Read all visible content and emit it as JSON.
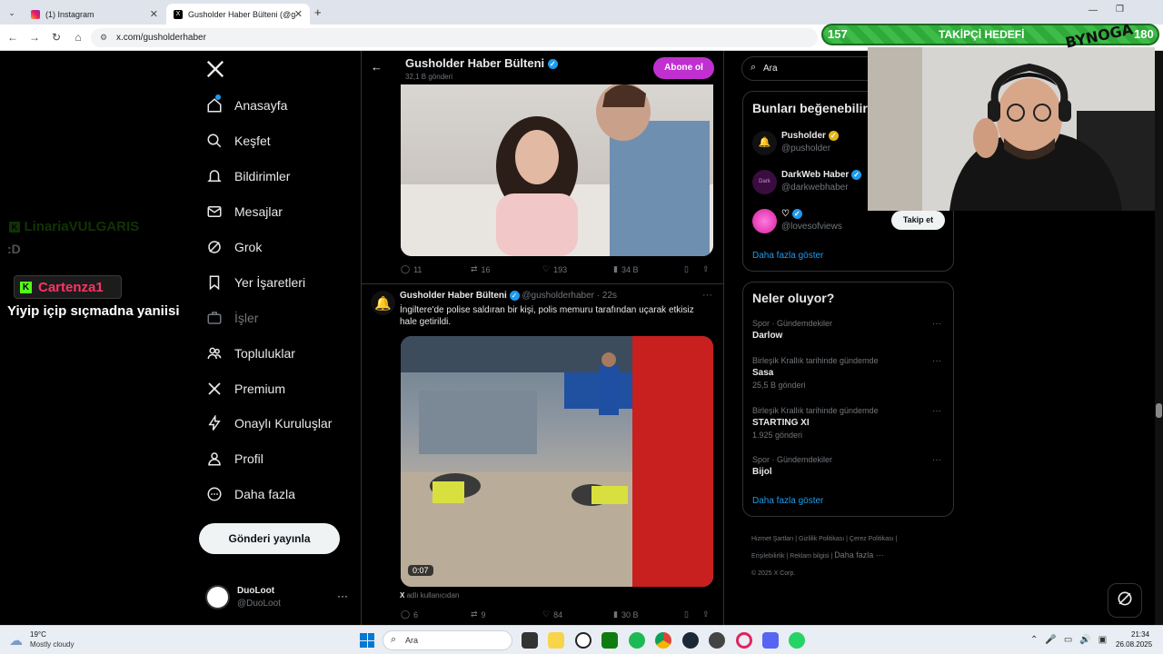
{
  "browser": {
    "tabs": [
      {
        "title": "(1) Instagram",
        "active": false
      },
      {
        "title": "Gusholder Haber Bülteni (@gus",
        "active": true
      }
    ],
    "url": "x.com/gusholderhaber"
  },
  "nav": {
    "items": [
      {
        "label": "Anasayfa",
        "icon": "home-icon"
      },
      {
        "label": "Keşfet",
        "icon": "search-icon"
      },
      {
        "label": "Bildirimler",
        "icon": "bell-icon"
      },
      {
        "label": "Mesajlar",
        "icon": "mail-icon"
      },
      {
        "label": "Grok",
        "icon": "grok-icon"
      },
      {
        "label": "Yer İşaretleri",
        "icon": "bookmark-icon"
      },
      {
        "label": "İşler",
        "icon": "briefcase-icon"
      },
      {
        "label": "Topluluklar",
        "icon": "people-icon"
      },
      {
        "label": "Premium",
        "icon": "x-logo-icon"
      },
      {
        "label": "Onaylı Kuruluşlar",
        "icon": "lightning-icon"
      },
      {
        "label": "Profil",
        "icon": "person-icon"
      },
      {
        "label": "Daha fazla",
        "icon": "more-circle-icon"
      }
    ],
    "post_button": "Gönderi yayınla",
    "account": {
      "name": "DuoLoot",
      "handle": "@DuoLoot"
    }
  },
  "profile_header": {
    "name": "Gusholder Haber Bülteni",
    "posts": "32,1 B gönderi",
    "subscribe": "Abone ol"
  },
  "tweet1": {
    "replies": "11",
    "retweets": "16",
    "likes": "193",
    "views": "34 B"
  },
  "tweet2": {
    "name": "Gusholder Haber Bülteni",
    "handle": "@gusholderhaber",
    "time": "· 22s",
    "text": "İngiltere'de polise saldıran bir kişi, polis memuru tarafından uçarak etkisiz hale getirildi.",
    "duration": "0:07",
    "caption_x": "X",
    "caption": "adlı kullanıcıdan",
    "replies": "6",
    "retweets": "9",
    "likes": "84",
    "views": "30 B"
  },
  "search": {
    "placeholder": "Ara"
  },
  "suggestions": {
    "title": "Bunları beğenebilir",
    "accounts": [
      {
        "name": "Pusholder",
        "handle": "@pusholder"
      },
      {
        "name": "DarkWeb Haber",
        "handle": "@darkwebhaber"
      },
      {
        "name": "",
        "handle": "@lovesofviews"
      }
    ],
    "follow": "Takip et",
    "more": "Daha fazla göster"
  },
  "trends": {
    "title": "Neler oluyor?",
    "items": [
      {
        "category": "Spor · Gündemdekiler",
        "name": "Darlow",
        "count": ""
      },
      {
        "category": "Birleşik Krallık tarihinde gündemde",
        "name": "Sasa",
        "count": "25,5 B gönderi"
      },
      {
        "category": "Birleşik Krallık tarihinde gündemde",
        "name": "STARTING XI",
        "count": "1.925 gönderi"
      },
      {
        "category": "Spor · Gündemdekiler",
        "name": "Bijol",
        "count": ""
      }
    ],
    "more": "Daha fazla göster"
  },
  "footer": {
    "links": [
      "Hizmet Şartları",
      "Gizlilik Politikası",
      "Çerez Politikası",
      "Erişilebilirlik",
      "Reklam bilgisi",
      "Daha fazla ···"
    ],
    "copyright": "© 2025 X Corp."
  },
  "stream": {
    "goal_count": "157",
    "goal_label": "TAKİPÇİ HEDEFİ",
    "goal_target": "180",
    "brand": "BYNOGA",
    "chat": [
      {
        "user": "LinariaVULGARIS",
        "msg": ":D",
        "faded": true
      },
      {
        "user": "Cartenza1",
        "msg": "Yiyip içip sıçmadna yaniisi",
        "faded": false
      }
    ]
  },
  "taskbar": {
    "weather_temp": "19°C",
    "weather_desc": "Mostly cloudy",
    "search": "Ara",
    "time": "21:34",
    "date": "26.08.2025"
  },
  "colors": {
    "x_blue": "#1d9bf0",
    "subscribe": "#c030d0",
    "goal_green": "#2faa3a",
    "kick_green": "#53fc18"
  }
}
